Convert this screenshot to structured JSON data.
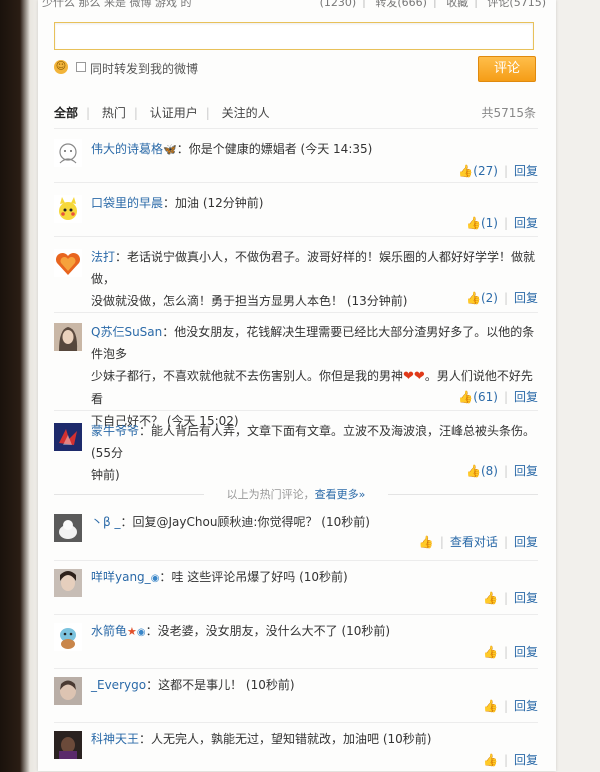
{
  "top_strip": {
    "left_text": "少什么 那么 来是 微博 游戏 的",
    "stats": [
      "(1230)",
      "转发(666)",
      "收藏",
      "评论(5715)"
    ]
  },
  "comment_box": {
    "value": "",
    "placeholder": "",
    "forward_label": "同时转发到我的微博",
    "submit_label": "评论"
  },
  "filters": {
    "tabs": [
      "全部",
      "热门",
      "认证用户",
      "关注的人"
    ],
    "total": "共5715条"
  },
  "hot_divider": {
    "text": "以上为热门评论，",
    "more": "查看更多»"
  },
  "comments": [
    {
      "user": "伟大的诗葛格",
      "badge": "🦋",
      "text": "你是个健康的嫖娼者 (今天 14:35)",
      "likes": "(27)",
      "reply": "回复"
    },
    {
      "user": "口袋里的早晨",
      "text": "加油 (12分钟前)",
      "likes": "(1)",
      "reply": "回复"
    },
    {
      "user": "法打",
      "text_line1": "老话说宁做真小人，不做伪君子。波哥好样的！娱乐圈的人都好好学学！做就做，",
      "text_line2": "没做就没做，怎么滴！勇于担当方显男人本色！ (13分钟前)",
      "likes": "(2)",
      "reply": "回复"
    },
    {
      "user": "Q苏仨SuSan",
      "text_line1": "他没女朋友，花钱解决生理需要已经比大部分渣男好多了。以他的条件泡多",
      "text_line2a": "少妹子都行，不喜欢就他就不去伤害别人。你但是我的男神",
      "text_line2b": "。男人们说他不好先看",
      "text_line3": "下自己好不？ (今天 15:02)",
      "likes": "(61)",
      "reply": "回复"
    },
    {
      "user": "蒙牛爷爷",
      "text_line1": "能人背后有人弄，文章下面有文章。立波不及海波浪，汪峰总被头条伤。 (55分",
      "text_line2": "钟前)",
      "likes": "(8)",
      "reply": "回复"
    },
    {
      "user": "丶β _",
      "text": "回复@JayChou顾秋迪:你觉得呢？ (10秒前)",
      "view_conversation": "查看对话",
      "reply": "回复"
    },
    {
      "user": "咩咩yang_",
      "text": "哇 这些评论吊爆了好吗 (10秒前)",
      "reply": "回复"
    },
    {
      "user": "水箭龟",
      "text": "没老婆，没女朋友，没什么大不了 (10秒前)",
      "reply": "回复"
    },
    {
      "user": "_Everygo",
      "text": "这都不是事儿！ (10秒前)",
      "reply": "回复"
    },
    {
      "user": "科神天王",
      "text": "人无完人，孰能无过，望知错就改，加油吧 (10秒前)",
      "reply": "回复"
    }
  ]
}
